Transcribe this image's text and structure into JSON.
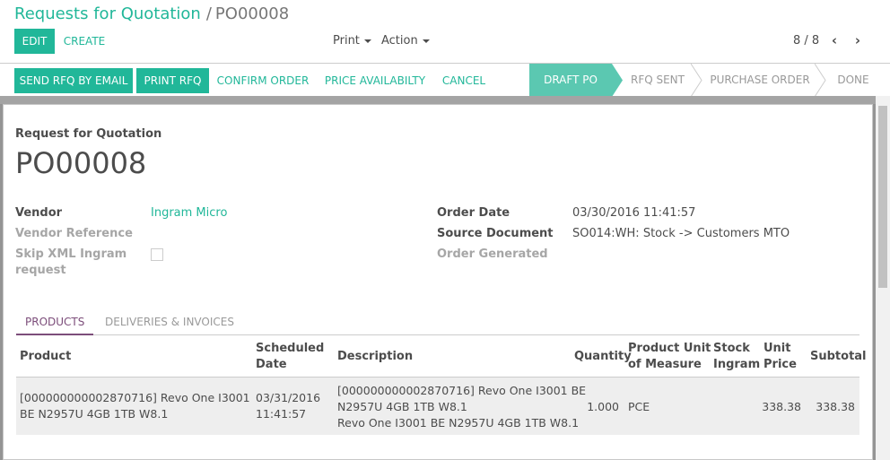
{
  "breadcrumb": {
    "parent": "Requests for Quotation",
    "separator": "/",
    "current": "PO00008"
  },
  "buttons": {
    "edit": "EDIT",
    "create": "CREATE"
  },
  "menus": {
    "print": "Print",
    "action": "Action"
  },
  "pager": {
    "value": "8 / 8",
    "prev": "‹",
    "next": "›"
  },
  "statusbar": {
    "send_rfq": "SEND RFQ BY EMAIL",
    "print_rfq": "PRINT RFQ",
    "confirm": "CONFIRM ORDER",
    "price": "PRICE AVAILABILTY",
    "cancel": "CANCEL",
    "stages": [
      "DRAFT PO",
      "RFQ SENT",
      "PURCHASE ORDER",
      "DONE"
    ],
    "active_stage": "DRAFT PO"
  },
  "form": {
    "doc_type": "Request for Quotation",
    "name": "PO00008",
    "vendor_label": "Vendor",
    "vendor": "Ingram Micro",
    "vendor_ref_label": "Vendor Reference",
    "skip_xml_label_1": "Skip XML Ingram",
    "skip_xml_label_2": "request",
    "order_date_label": "Order Date",
    "order_date": "03/30/2016 11:41:57",
    "source_doc_label": "Source Document",
    "source_doc": "SO014:WH: Stock -> Customers MTO",
    "order_generated_label": "Order Generated"
  },
  "tabs": [
    "PRODUCTS",
    "DELIVERIES & INVOICES"
  ],
  "table": {
    "headers": {
      "product": "Product",
      "scheduled_1": "Scheduled",
      "scheduled_2": "Date",
      "description": "Description",
      "quantity": "Quantity",
      "uom_1": "Product Unit",
      "uom_2": "of Measure",
      "stock_1": "Stock",
      "stock_2": "Ingram",
      "price_1": "Unit",
      "price_2": "Price",
      "subtotal": "Subtotal"
    },
    "rows": [
      {
        "product_1": "[000000000002870716] Revo One I3001",
        "product_2": "BE N2957U 4GB 1TB W8.1",
        "date_1": "03/31/2016",
        "date_2": "11:41:57",
        "desc_1": "[000000000002870716] Revo One I3001 BE",
        "desc_2": "N2957U 4GB 1TB W8.1",
        "desc_3": "Revo One I3001 BE N2957U 4GB 1TB W8.1",
        "quantity": "1.000",
        "uom": "PCE",
        "unit_price": "338.38",
        "subtotal": "338.38"
      }
    ]
  },
  "colors": {
    "accent": "#21b799",
    "tab_active": "#7c4d7a",
    "stage_active": "#5bc8b1"
  }
}
